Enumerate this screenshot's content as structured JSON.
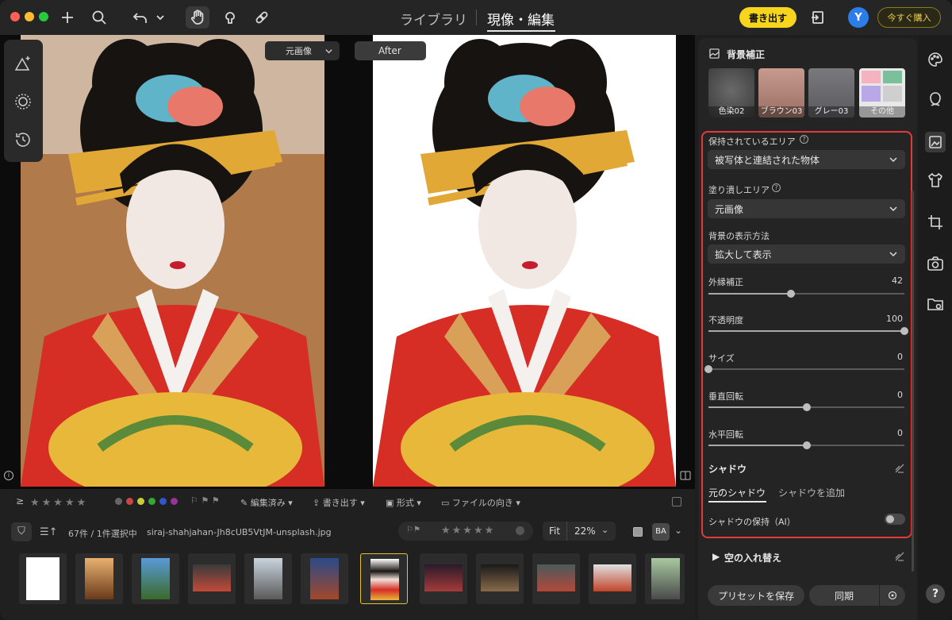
{
  "topbar": {
    "tabs": [
      "ライブラリ",
      "現像・編集"
    ],
    "export_label": "書き出す",
    "avatar_initial": "Y",
    "buy_label": "今すぐ購入"
  },
  "canvas": {
    "before_dropdown": "元画像",
    "after_label": "After"
  },
  "bottom": {
    "filter_bar": {
      "edited_label": "編集済み",
      "export_label": "書き出す",
      "format_label": "形式",
      "orientation_label": "ファイルの向き"
    },
    "count_label": "67件 / 1件選択中",
    "filename": "siraj-shahjahan-Jh8cUB5VtJM-unsplash.jpg",
    "fit_label": "Fit",
    "zoom_label": "22%",
    "ba_label": "BA"
  },
  "panel": {
    "title": "背景補正",
    "presets": [
      "色染02",
      "ブラウン03",
      "グレー03",
      "その他"
    ],
    "preserved_area": {
      "label": "保持されているエリア",
      "value": "被写体と連結された物体"
    },
    "fill_area": {
      "label": "塗り潰しエリア",
      "value": "元画像"
    },
    "bg_display": {
      "label": "背景の表示方法",
      "value": "拡大して表示"
    },
    "sliders": [
      {
        "label": "外縁補正",
        "value": "42",
        "level": 0.42
      },
      {
        "label": "不透明度",
        "value": "100",
        "level": 1.0
      },
      {
        "label": "サイズ",
        "value": "0",
        "level": 0.0
      },
      {
        "label": "垂直回転",
        "value": "0",
        "level": 0.5
      },
      {
        "label": "水平回転",
        "value": "0",
        "level": 0.5
      }
    ],
    "shadow": {
      "title": "シャドウ",
      "tab_original": "元のシャドウ",
      "tab_add": "シャドウを追加",
      "keep_label": "シャドウの保持（AI）"
    },
    "sky_label": "空の入れ替え",
    "save_preset_label": "プリセットを保存",
    "sync_label": "同期"
  }
}
